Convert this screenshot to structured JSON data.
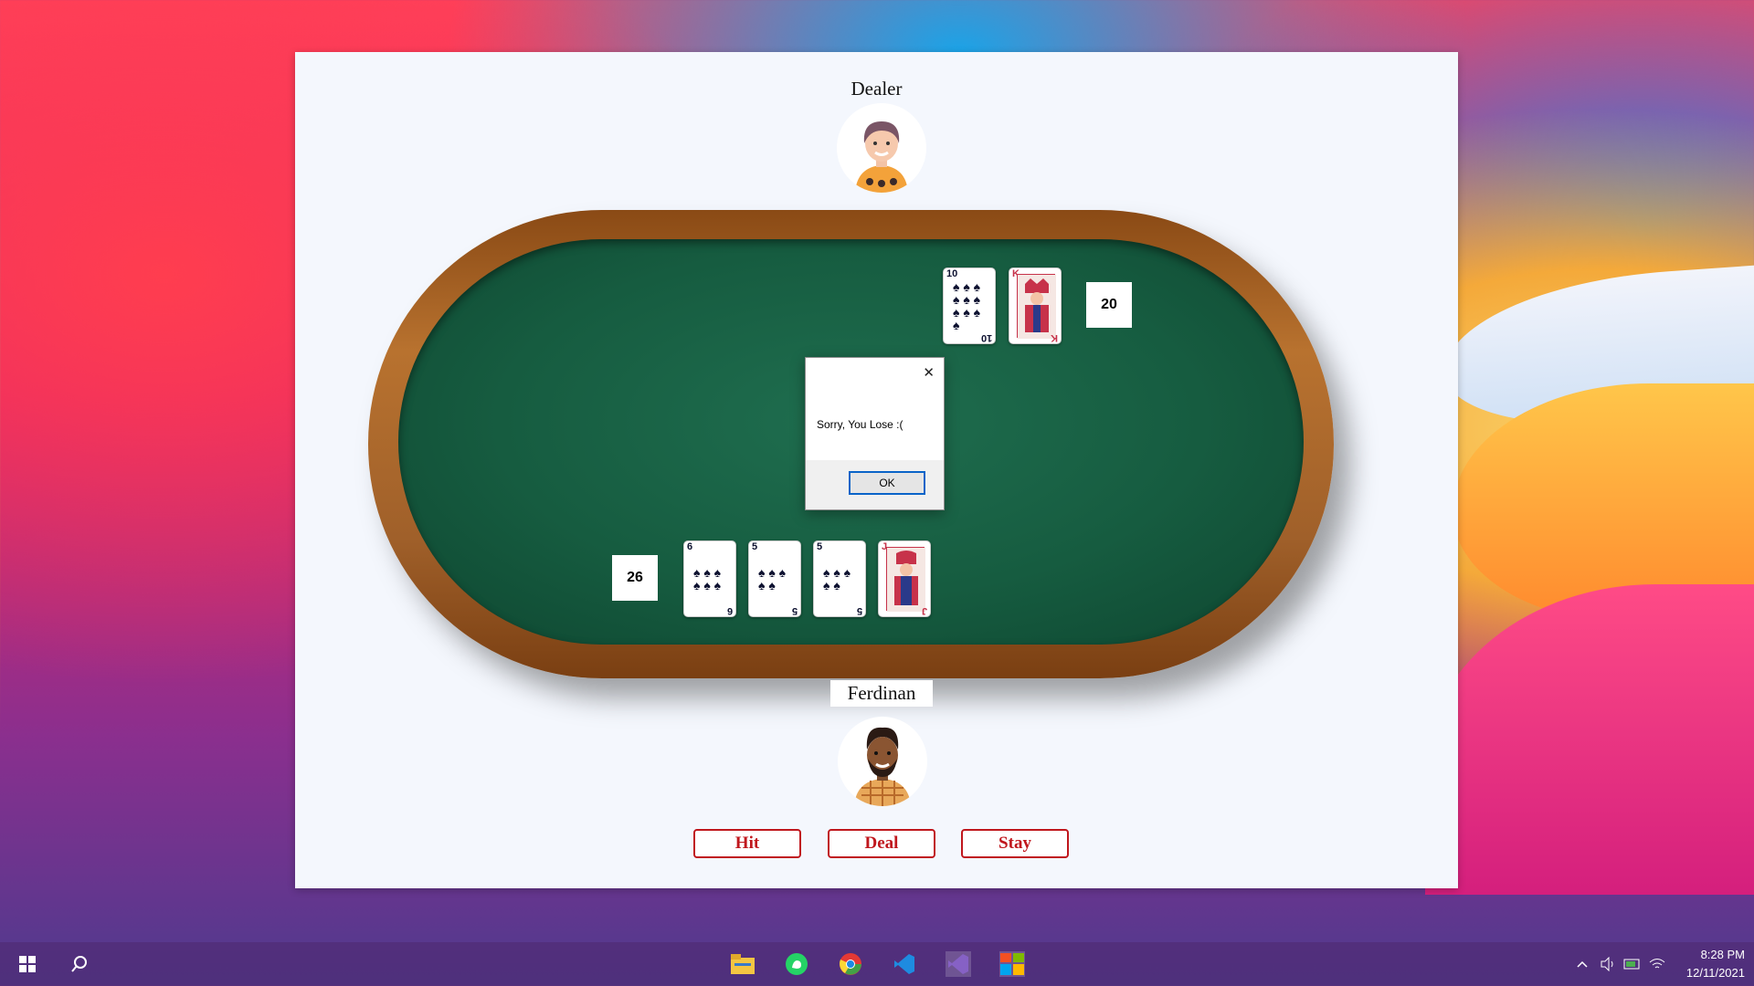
{
  "window": {
    "dealer_name": "Dealer",
    "player_name": "Ferdinan"
  },
  "dealer": {
    "score": "20",
    "cards": [
      {
        "rank": "10",
        "suit": "spades",
        "color": "black"
      },
      {
        "rank": "K",
        "suit": "hearts",
        "color": "red",
        "face": true
      }
    ]
  },
  "player": {
    "score": "26",
    "cards": [
      {
        "rank": "6",
        "suit": "spades",
        "color": "black"
      },
      {
        "rank": "5",
        "suit": "spades",
        "color": "black"
      },
      {
        "rank": "5",
        "suit": "spades",
        "color": "black"
      },
      {
        "rank": "J",
        "suit": "hearts",
        "color": "red",
        "face": true
      }
    ]
  },
  "dialog": {
    "message": "Sorry, You Lose :(",
    "ok_label": "OK",
    "close_icon": "close-icon"
  },
  "buttons": {
    "hit_label": "Hit",
    "deal_label": "Deal",
    "stay_label": "Stay"
  },
  "taskbar": {
    "time": "8:28 PM",
    "date": "12/11/2021",
    "apps": [
      "file-explorer-icon",
      "whatsapp-icon",
      "chrome-icon",
      "vscode-icon",
      "visual-studio-icon",
      "winforms-app-icon"
    ]
  },
  "colors": {
    "felt": "#165c40",
    "wood": "#a0602a",
    "button_accent": "#c0171d"
  }
}
